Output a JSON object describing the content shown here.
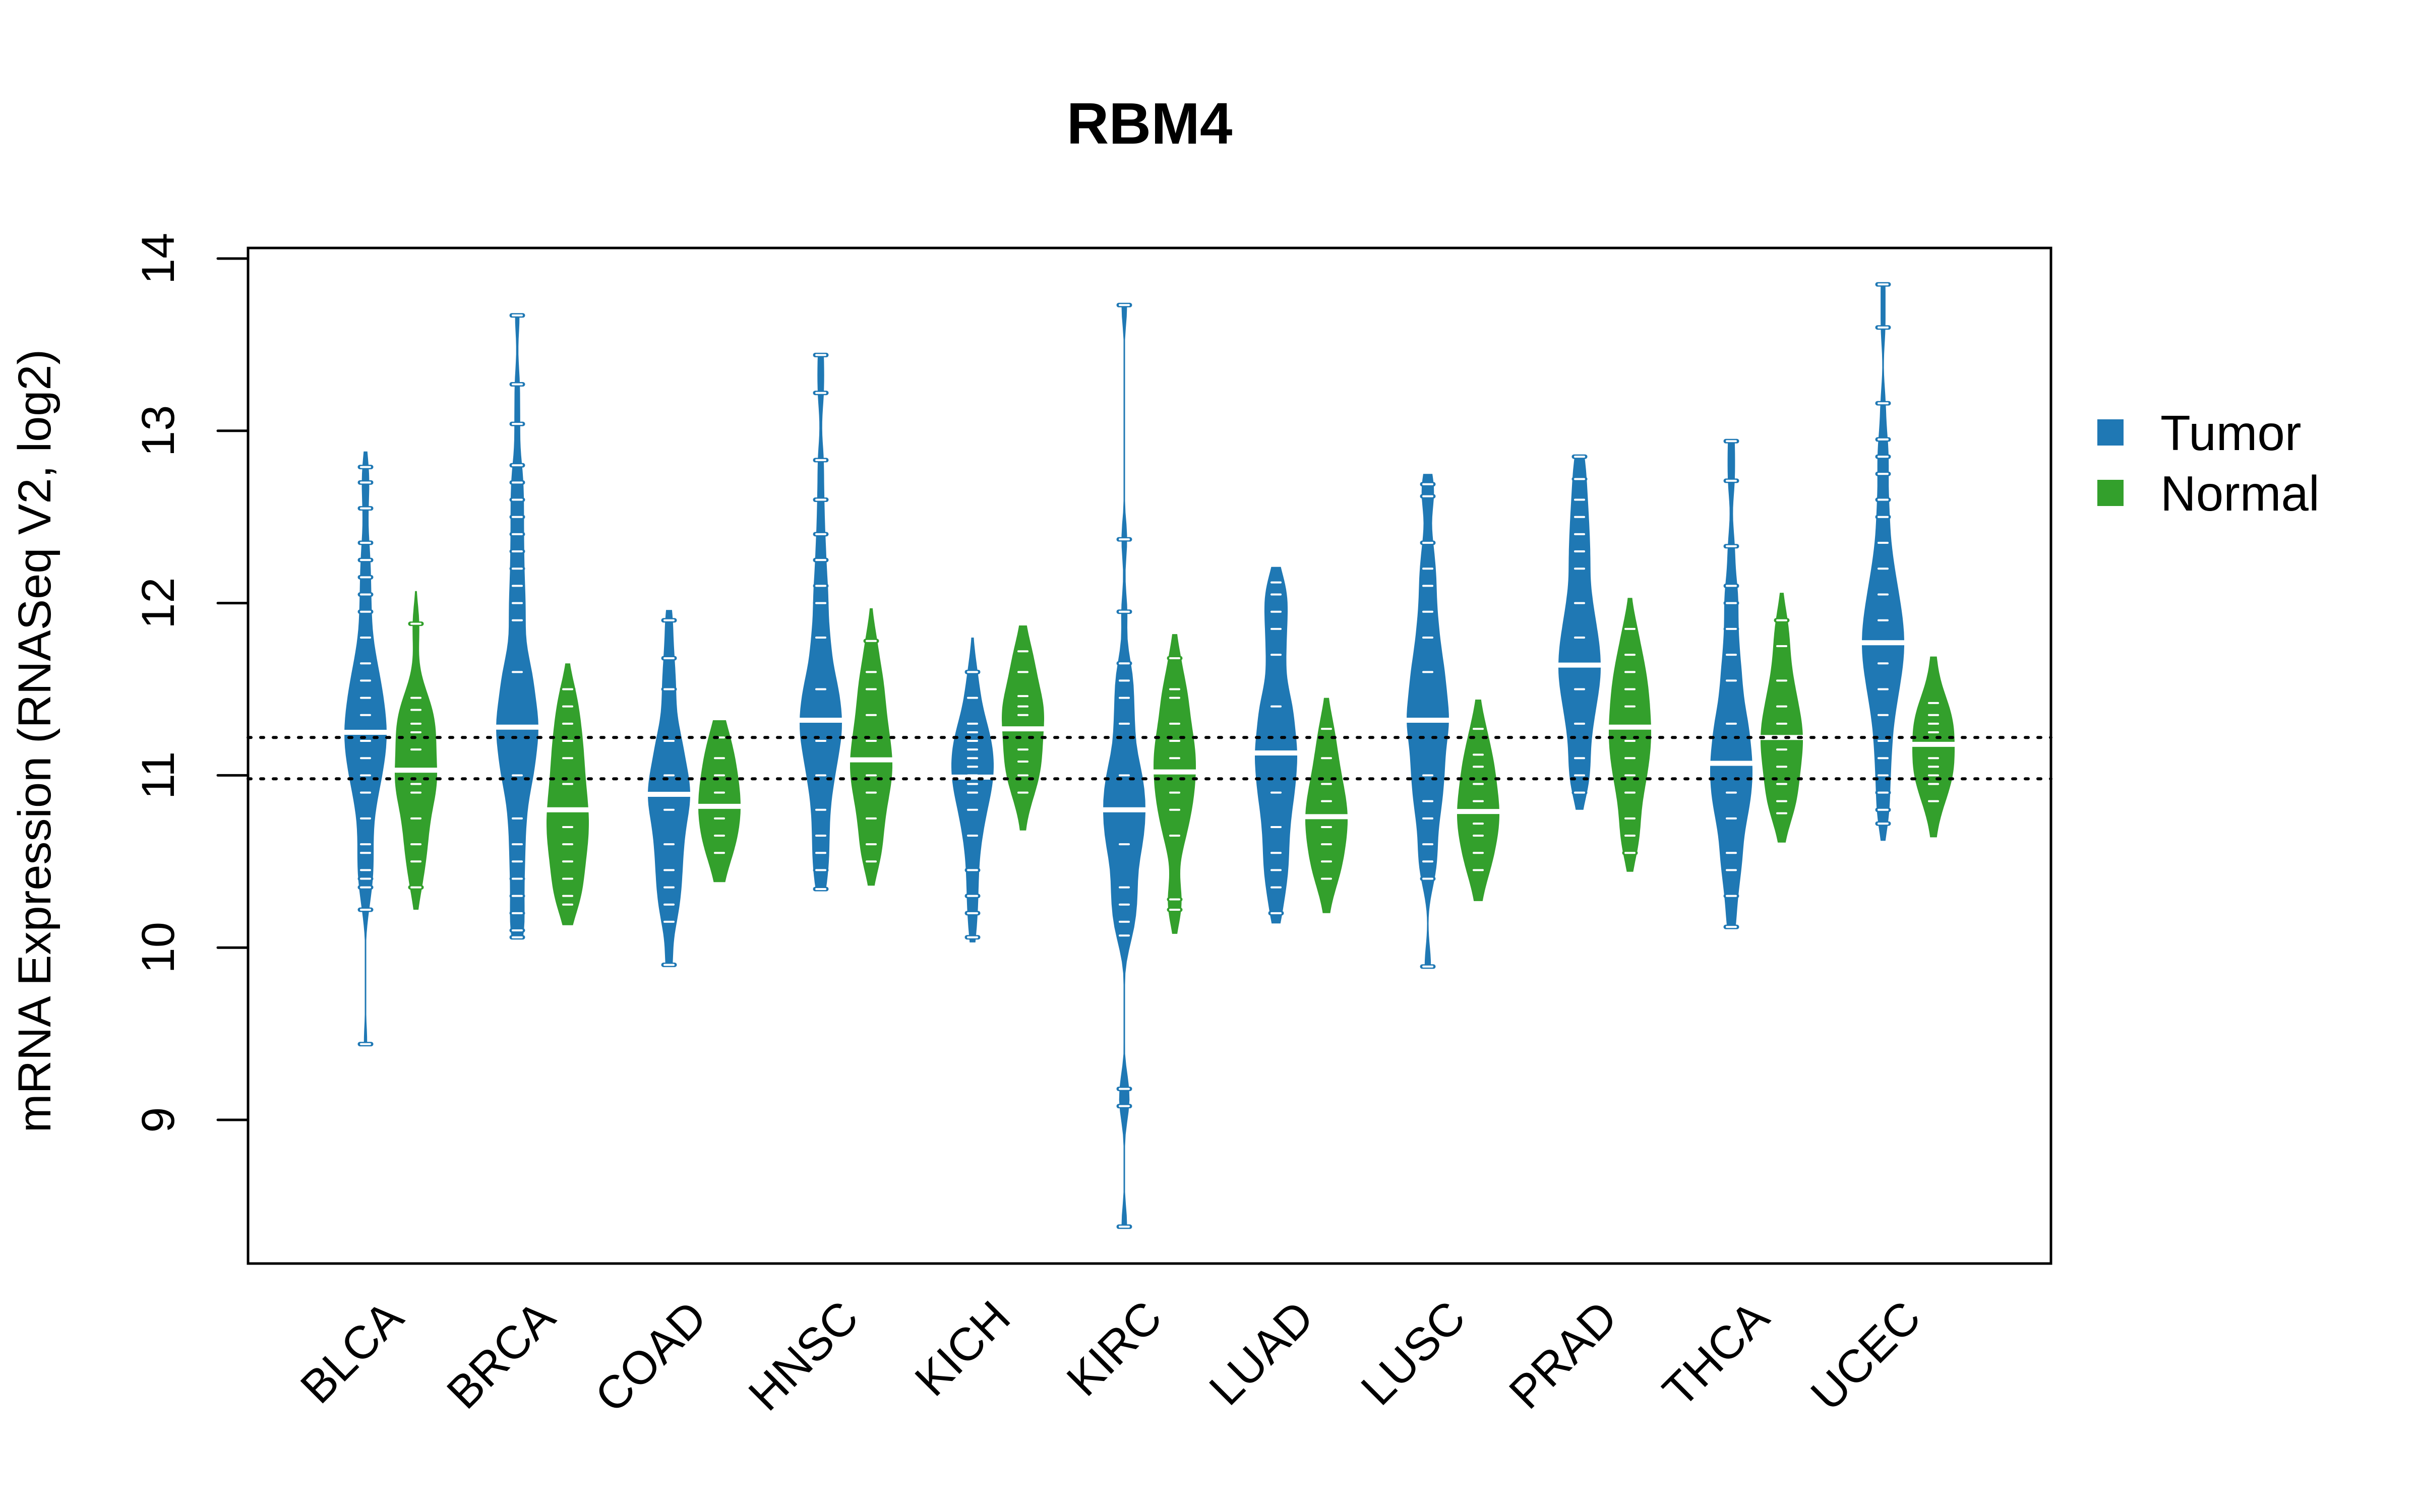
{
  "chart_data": {
    "type": "beanplot",
    "title": "RBM4",
    "xlabel": "",
    "ylabel": "mRNA Expression (RNASeq V2, log2)",
    "ylim": [
      8.17,
      14.06
    ],
    "yticks": [
      9,
      10,
      11,
      12,
      13,
      14
    ],
    "grid": false,
    "legend": {
      "placement": "right",
      "entries": [
        {
          "name": "Tumor",
          "color": "#1F78B4"
        },
        {
          "name": "Normal",
          "color": "#33A02C"
        }
      ]
    },
    "reference_lines": [
      11.22,
      10.98
    ],
    "categories": [
      "BLCA",
      "BRCA",
      "COAD",
      "HNSC",
      "KICH",
      "KIRC",
      "LUAD",
      "LUSC",
      "PRAD",
      "THCA",
      "UCEC"
    ],
    "series": [
      {
        "name": "Tumor",
        "color": "#1F78B4",
        "beans": [
          {
            "median": 11.25,
            "min": 9.44,
            "max": 12.88,
            "points": [
              9.44,
              10.22,
              10.35,
              10.4,
              10.45,
              10.55,
              10.6,
              10.75,
              10.9,
              11.0,
              11.1,
              11.2,
              11.25,
              11.35,
              11.45,
              11.55,
              11.65,
              11.8,
              11.95,
              12.05,
              12.15,
              12.25,
              12.35,
              12.55,
              12.7,
              12.79
            ]
          },
          {
            "median": 11.28,
            "min": 10.06,
            "max": 13.67,
            "points": [
              10.06,
              10.1,
              10.2,
              10.3,
              10.4,
              10.5,
              10.6,
              10.75,
              11.0,
              11.28,
              11.6,
              11.9,
              12.0,
              12.1,
              12.2,
              12.3,
              12.4,
              12.5,
              12.6,
              12.7,
              12.8,
              13.04,
              13.27,
              13.67
            ]
          },
          {
            "median": 10.89,
            "min": 9.9,
            "max": 11.96,
            "points": [
              9.9,
              10.15,
              10.25,
              10.35,
              10.45,
              10.6,
              10.8,
              10.89,
              11.0,
              11.2,
              11.5,
              11.68,
              11.9
            ]
          },
          {
            "median": 11.32,
            "min": 10.34,
            "max": 13.44,
            "points": [
              10.34,
              10.45,
              10.55,
              10.65,
              10.8,
              11.0,
              11.2,
              11.32,
              11.5,
              11.8,
              12.0,
              12.1,
              12.25,
              12.4,
              12.6,
              12.83,
              13.22,
              13.44
            ]
          },
          {
            "median": 10.99,
            "min": 10.03,
            "max": 11.8,
            "points": [
              10.06,
              10.2,
              10.3,
              10.45,
              10.65,
              10.8,
              10.9,
              10.95,
              11.0,
              11.05,
              11.1,
              11.15,
              11.2,
              11.25,
              11.3,
              11.45,
              11.6
            ]
          },
          {
            "median": 10.8,
            "min": 8.38,
            "max": 13.73,
            "points": [
              8.38,
              9.08,
              9.18,
              10.07,
              10.15,
              10.25,
              10.35,
              10.6,
              10.8,
              11.0,
              11.3,
              11.45,
              11.55,
              11.65,
              11.95,
              12.37,
              13.73
            ]
          },
          {
            "median": 11.13,
            "min": 10.14,
            "max": 12.21,
            "points": [
              10.2,
              10.35,
              10.45,
              10.55,
              10.7,
              10.9,
              11.13,
              11.4,
              11.7,
              11.85,
              11.95,
              12.05,
              12.12
            ]
          },
          {
            "median": 11.32,
            "min": 9.89,
            "max": 12.75,
            "points": [
              9.89,
              10.4,
              10.5,
              10.6,
              10.75,
              10.85,
              11.0,
              11.32,
              11.6,
              11.8,
              11.95,
              12.1,
              12.2,
              12.35,
              12.62,
              12.69
            ]
          },
          {
            "median": 11.64,
            "min": 10.8,
            "max": 12.85,
            "points": [
              10.9,
              11.0,
              11.1,
              11.3,
              11.5,
              11.64,
              11.8,
              12.0,
              12.2,
              12.3,
              12.4,
              12.5,
              12.6,
              12.72,
              12.85
            ]
          },
          {
            "median": 11.07,
            "min": 10.12,
            "max": 12.94,
            "points": [
              10.12,
              10.3,
              10.45,
              10.55,
              10.75,
              10.9,
              11.07,
              11.3,
              11.55,
              11.7,
              11.85,
              12.0,
              12.1,
              12.33,
              12.71,
              12.94
            ]
          },
          {
            "median": 11.77,
            "min": 10.62,
            "max": 13.85,
            "points": [
              10.72,
              10.8,
              10.9,
              11.0,
              11.1,
              11.2,
              11.35,
              11.5,
              11.65,
              11.77,
              11.9,
              12.05,
              12.2,
              12.35,
              12.5,
              12.6,
              12.75,
              12.85,
              12.95,
              13.16,
              13.6,
              13.85
            ]
          }
        ]
      },
      {
        "name": "Normal",
        "color": "#33A02C",
        "beans": [
          {
            "median": 11.03,
            "min": 10.22,
            "max": 12.07,
            "points": [
              10.35,
              10.5,
              10.6,
              10.75,
              10.9,
              10.95,
              11.03,
              11.15,
              11.25,
              11.3,
              11.38,
              11.45,
              11.88
            ]
          },
          {
            "median": 10.8,
            "min": 10.13,
            "max": 11.65,
            "points": [
              10.25,
              10.3,
              10.4,
              10.5,
              10.6,
              10.7,
              10.8,
              10.95,
              11.1,
              11.2,
              11.3,
              11.4,
              11.5
            ]
          },
          {
            "median": 10.82,
            "min": 10.38,
            "max": 11.32,
            "points": [
              10.55,
              10.65,
              10.75,
              10.82,
              10.9,
              11.0,
              11.1,
              11.22
            ]
          },
          {
            "median": 11.09,
            "min": 10.36,
            "max": 11.97,
            "points": [
              10.5,
              10.6,
              10.75,
              10.9,
              11.0,
              11.09,
              11.2,
              11.35,
              11.5,
              11.6,
              11.78
            ]
          },
          {
            "median": 11.27,
            "min": 10.68,
            "max": 11.87,
            "points": [
              10.9,
              11.0,
              11.08,
              11.15,
              11.27,
              11.35,
              11.4,
              11.46,
              11.6,
              11.72
            ]
          },
          {
            "median": 11.02,
            "min": 10.08,
            "max": 11.82,
            "points": [
              10.22,
              10.28,
              10.65,
              10.8,
              10.9,
              11.02,
              11.1,
              11.2,
              11.3,
              11.45,
              11.5,
              11.68
            ]
          },
          {
            "median": 10.76,
            "min": 10.2,
            "max": 11.45,
            "points": [
              10.4,
              10.5,
              10.6,
              10.7,
              10.76,
              10.85,
              10.95,
              11.1,
              11.27
            ]
          },
          {
            "median": 10.79,
            "min": 10.27,
            "max": 11.44,
            "points": [
              10.45,
              10.55,
              10.65,
              10.72,
              10.79,
              10.85,
              10.95,
              11.05,
              11.12,
              11.27
            ]
          },
          {
            "median": 11.28,
            "min": 10.44,
            "max": 12.03,
            "points": [
              10.55,
              10.65,
              10.75,
              10.9,
              11.0,
              11.1,
              11.2,
              11.28,
              11.4,
              11.5,
              11.6,
              11.7,
              11.85
            ]
          },
          {
            "median": 11.22,
            "min": 10.61,
            "max": 12.06,
            "points": [
              10.78,
              10.85,
              10.95,
              11.05,
              11.15,
              11.22,
              11.3,
              11.4,
              11.55,
              11.75,
              11.9
            ]
          },
          {
            "median": 11.18,
            "min": 10.64,
            "max": 11.69,
            "points": [
              10.85,
              10.95,
              11.0,
              11.05,
              11.1,
              11.18,
              11.25,
              11.3,
              11.35,
              11.42
            ]
          }
        ]
      }
    ]
  }
}
